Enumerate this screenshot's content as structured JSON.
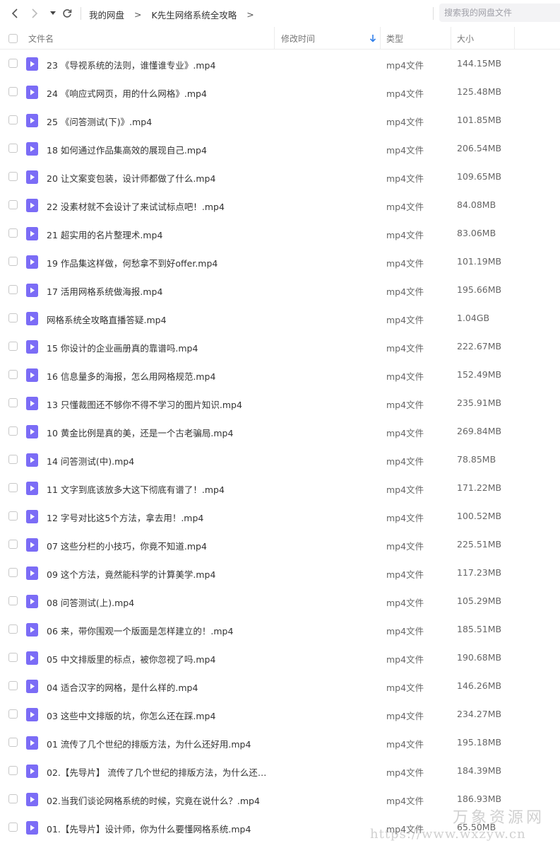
{
  "nav": {
    "back_icon": "chevron-left-icon",
    "forward_icon": "chevron-right-icon",
    "dropdown_icon": "caret-down-icon",
    "refresh_icon": "refresh-icon",
    "breadcrumb": [
      {
        "label": "我的网盘"
      },
      {
        "label": "K先生网络系统全攻略"
      }
    ],
    "search_placeholder": "搜索我的网盘文件"
  },
  "header": {
    "name": "文件名",
    "modified": "修改时间",
    "type": "类型",
    "size": "大小"
  },
  "colors": {
    "file_icon": "#7b6cf6",
    "sort_arrow": "#2f7fea"
  },
  "files": [
    {
      "name": "23 《导视系统的法则，谁懂谁专业》.mp4",
      "type": "mp4文件",
      "size": "144.15MB"
    },
    {
      "name": "24 《响应式网页，用的什么网格》.mp4",
      "type": "mp4文件",
      "size": "125.48MB"
    },
    {
      "name": "25 《问答测试(下)》.mp4",
      "type": "mp4文件",
      "size": "101.85MB"
    },
    {
      "name": "18 如何通过作品集高效的展现自己.mp4",
      "type": "mp4文件",
      "size": "206.54MB"
    },
    {
      "name": "20 让文案变包装，设计师都做了什么.mp4",
      "type": "mp4文件",
      "size": "109.65MB"
    },
    {
      "name": "22 没素材就不会设计了来试试标点吧！.mp4",
      "type": "mp4文件",
      "size": "84.08MB"
    },
    {
      "name": "21 超实用的名片整理术.mp4",
      "type": "mp4文件",
      "size": "83.06MB"
    },
    {
      "name": "19 作品集这样做，何愁拿不到好offer.mp4",
      "type": "mp4文件",
      "size": "101.19MB"
    },
    {
      "name": "17 活用网格系统做海报.mp4",
      "type": "mp4文件",
      "size": "195.66MB"
    },
    {
      "name": "网格系统全攻略直播答疑.mp4",
      "type": "mp4文件",
      "size": "1.04GB"
    },
    {
      "name": "15 你设计的企业画册真的靠谱吗.mp4",
      "type": "mp4文件",
      "size": "222.67MB"
    },
    {
      "name": "16 信息量多的海报，怎么用网格规范.mp4",
      "type": "mp4文件",
      "size": "152.49MB"
    },
    {
      "name": "13 只懂裁图还不够你不得不学习的图片知识.mp4",
      "type": "mp4文件",
      "size": "235.91MB"
    },
    {
      "name": "10 黄金比例是真的美，还是一个古老骗局.mp4",
      "type": "mp4文件",
      "size": "269.84MB"
    },
    {
      "name": "14 问答测试(中).mp4",
      "type": "mp4文件",
      "size": "78.85MB"
    },
    {
      "name": "11 文字到底该放多大这下彻底有谱了！.mp4",
      "type": "mp4文件",
      "size": "171.22MB"
    },
    {
      "name": "12 字号对比这5个方法，拿去用！.mp4",
      "type": "mp4文件",
      "size": "100.52MB"
    },
    {
      "name": "07 这些分栏的小技巧，你竟不知道.mp4",
      "type": "mp4文件",
      "size": "225.51MB"
    },
    {
      "name": "09 这个方法，竟然能科学的计算美学.mp4",
      "type": "mp4文件",
      "size": "117.23MB"
    },
    {
      "name": "08 问答测试(上).mp4",
      "type": "mp4文件",
      "size": "105.29MB"
    },
    {
      "name": "06 来，带你围观一个版面是怎样建立的！.mp4",
      "type": "mp4文件",
      "size": "185.51MB"
    },
    {
      "name": "05 中文排版里的标点，被你忽视了吗.mp4",
      "type": "mp4文件",
      "size": "190.68MB"
    },
    {
      "name": "04 适合汉字的网格，是什么样的.mp4",
      "type": "mp4文件",
      "size": "146.26MB"
    },
    {
      "name": "03 这些中文排版的坑，你怎么还在踩.mp4",
      "type": "mp4文件",
      "size": "234.27MB"
    },
    {
      "name": "01 流传了几个世纪的排版方法，为什么还好用.mp4",
      "type": "mp4文件",
      "size": "195.18MB"
    },
    {
      "name": "02.【先导片】 流传了几个世纪的排版方法，为什么还好...",
      "type": "mp4文件",
      "size": "184.39MB"
    },
    {
      "name": "02.当我们谈论网格系统的时候，究竟在说什么？.mp4",
      "type": "mp4文件",
      "size": "186.93MB"
    },
    {
      "name": "01.【先导片】设计师，你为什么要懂网格系统.mp4",
      "type": "mp4文件",
      "size": "65.50MB"
    }
  ],
  "watermark": {
    "text": "万象资源网",
    "url": "https://www.wxzyw.cn"
  }
}
